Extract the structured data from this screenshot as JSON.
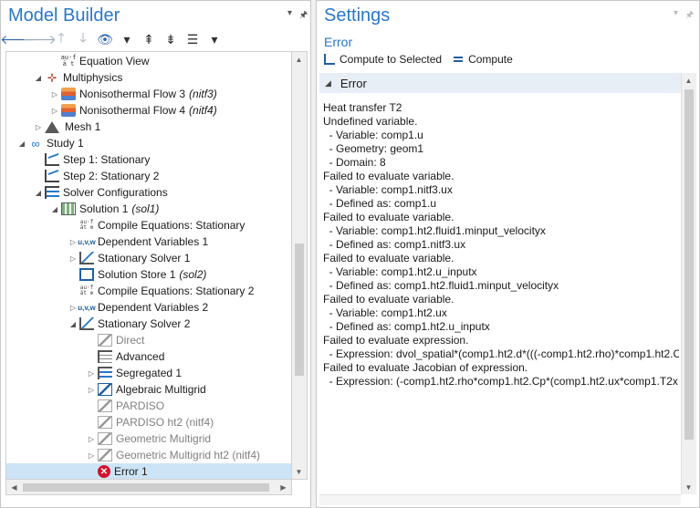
{
  "model_builder": {
    "title": "Model Builder",
    "pin_icon": "pin-icon",
    "menu_icon": "chevron-down-icon",
    "toolbar": [
      {
        "name": "back-arrow-icon",
        "glyph": "🡐",
        "style": ""
      },
      {
        "name": "forward-arrow-icon",
        "glyph": "🡒",
        "style": "dim"
      },
      {
        "name": "move-up-icon",
        "glyph": "🡑",
        "style": "dim"
      },
      {
        "name": "move-down-icon",
        "glyph": "🡓",
        "style": "dim"
      },
      {
        "name": "show-icon",
        "glyph": "👁",
        "style": ""
      },
      {
        "name": "chevron-down-icon",
        "glyph": "▾",
        "style": "dark"
      },
      {
        "name": "collapse-all-icon",
        "glyph": "⇞",
        "style": "dark"
      },
      {
        "name": "expand-all-icon",
        "glyph": "⇟",
        "style": "dark"
      },
      {
        "name": "view-list-icon",
        "glyph": "☰",
        "style": "dark"
      },
      {
        "name": "chevron-down-icon",
        "glyph": "▾",
        "style": "dark"
      }
    ],
    "tree": [
      {
        "label": "Equation View",
        "tag": "",
        "indent": 62,
        "twisty": "",
        "icon": "eq",
        "grey": false,
        "selected": false
      },
      {
        "label": "Multiphysics",
        "tag": "",
        "indent": 44,
        "twisty": "◢",
        "icon": "multi",
        "grey": false,
        "selected": false
      },
      {
        "label": "Nonisothermal Flow 3",
        "tag": "(nitf3)",
        "indent": 62,
        "twisty": "▷",
        "icon": "flow",
        "grey": false,
        "selected": false
      },
      {
        "label": "Nonisothermal Flow 4",
        "tag": "(nitf4)",
        "indent": 62,
        "twisty": "▷",
        "icon": "flow",
        "grey": false,
        "selected": false
      },
      {
        "label": "Mesh 1",
        "tag": "",
        "indent": 44,
        "twisty": "▷",
        "icon": "mesh",
        "grey": false,
        "selected": false
      },
      {
        "label": "Study 1",
        "tag": "",
        "indent": 26,
        "twisty": "◢",
        "icon": "study",
        "grey": false,
        "selected": false
      },
      {
        "label": "Step 1: Stationary",
        "tag": "",
        "indent": 44,
        "twisty": "",
        "icon": "step",
        "grey": false,
        "selected": false
      },
      {
        "label": "Step 2: Stationary 2",
        "tag": "",
        "indent": 44,
        "twisty": "",
        "icon": "step",
        "grey": false,
        "selected": false
      },
      {
        "label": "Solver Configurations",
        "tag": "",
        "indent": 44,
        "twisty": "◢",
        "icon": "solver",
        "grey": false,
        "selected": false
      },
      {
        "label": "Solution 1",
        "tag": "(sol1)",
        "indent": 62,
        "twisty": "◢",
        "icon": "sol",
        "grey": false,
        "selected": false
      },
      {
        "label": "Compile Equations: Stationary",
        "tag": "",
        "indent": 82,
        "twisty": "",
        "icon": "comp",
        "grey": false,
        "selected": false
      },
      {
        "label": "Dependent Variables 1",
        "tag": "",
        "indent": 82,
        "twisty": "▷",
        "icon": "uvw",
        "grey": false,
        "selected": false
      },
      {
        "label": "Stationary Solver 1",
        "tag": "",
        "indent": 82,
        "twisty": "▷",
        "icon": "ssolve",
        "grey": false,
        "selected": false
      },
      {
        "label": "Solution Store 1",
        "tag": "(sol2)",
        "indent": 82,
        "twisty": "",
        "icon": "store",
        "grey": false,
        "selected": false
      },
      {
        "label": "Compile Equations: Stationary 2",
        "tag": "",
        "indent": 82,
        "twisty": "",
        "icon": "comp",
        "grey": false,
        "selected": false
      },
      {
        "label": "Dependent Variables 2",
        "tag": "",
        "indent": 82,
        "twisty": "▷",
        "icon": "uvw",
        "grey": false,
        "selected": false
      },
      {
        "label": "Stationary Solver 2",
        "tag": "",
        "indent": 82,
        "twisty": "◢",
        "icon": "ssolve",
        "grey": false,
        "selected": false
      },
      {
        "label": "Direct",
        "tag": "",
        "indent": 102,
        "twisty": "",
        "icon": "direct",
        "grey": true,
        "selected": false
      },
      {
        "label": "Advanced",
        "tag": "",
        "indent": 102,
        "twisty": "",
        "icon": "adv",
        "grey": false,
        "selected": false
      },
      {
        "label": "Segregated 1",
        "tag": "",
        "indent": 102,
        "twisty": "▷",
        "icon": "seg",
        "grey": false,
        "selected": false
      },
      {
        "label": "Algebraic Multigrid",
        "tag": "",
        "indent": 102,
        "twisty": "▷",
        "icon": "amg",
        "grey": false,
        "selected": false
      },
      {
        "label": "PARDISO",
        "tag": "",
        "indent": 102,
        "twisty": "",
        "icon": "direct",
        "grey": true,
        "selected": false
      },
      {
        "label": "PARDISO ht2 (nitf4)",
        "tag": "",
        "indent": 102,
        "twisty": "",
        "icon": "direct",
        "grey": true,
        "selected": false
      },
      {
        "label": "Geometric Multigrid",
        "tag": "",
        "indent": 102,
        "twisty": "▷",
        "icon": "direct",
        "grey": true,
        "selected": false
      },
      {
        "label": "Geometric Multigrid ht2 (nitf4)",
        "tag": "",
        "indent": 102,
        "twisty": "▷",
        "icon": "direct",
        "grey": true,
        "selected": false
      },
      {
        "label": "Error 1",
        "tag": "",
        "indent": 102,
        "twisty": "",
        "icon": "err",
        "grey": false,
        "selected": true
      }
    ]
  },
  "settings": {
    "title": "Settings",
    "subtitle": "Error",
    "compute_selected_label": "Compute to Selected",
    "compute_label": "Compute",
    "section_title": "Error",
    "message_lines": [
      "Heat transfer T2",
      "Undefined variable.",
      "  - Variable: comp1.u",
      "  - Geometry: geom1",
      "  - Domain: 8",
      "Failed to evaluate variable.",
      "  - Variable: comp1.nitf3.ux",
      "  - Defined as: comp1.u",
      "Failed to evaluate variable.",
      "  - Variable: comp1.ht2.fluid1.minput_velocityx",
      "  - Defined as: comp1.nitf3.ux",
      "Failed to evaluate variable.",
      "  - Variable: comp1.ht2.u_inputx",
      "  - Defined as: comp1.ht2.fluid1.minput_velocityx",
      "Failed to evaluate variable.",
      "  - Variable: comp1.ht2.ux",
      "  - Defined as: comp1.ht2.u_inputx",
      "Failed to evaluate expression.",
      "  - Expression: dvol_spatial*(comp1.ht2.d*(((-comp1.ht2.rho)*comp1.ht2.C",
      "Failed to evaluate Jacobian of expression.",
      "  - Expression: (-comp1.ht2.rho*comp1.ht2.Cp*(comp1.ht2.ux*comp1.T2x"
    ]
  }
}
